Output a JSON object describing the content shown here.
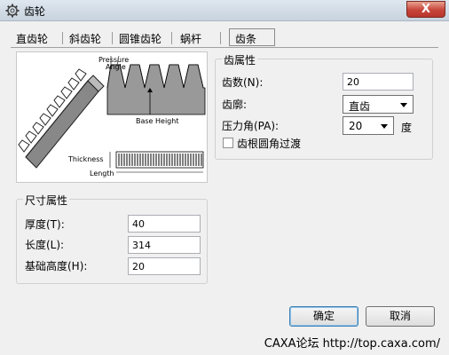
{
  "window": {
    "title": "齿轮",
    "close_label": "X"
  },
  "tabs": [
    {
      "label": "直齿轮"
    },
    {
      "label": "斜齿轮"
    },
    {
      "label": "圆锥齿轮"
    },
    {
      "label": "蜗杆"
    },
    {
      "label": "齿条",
      "active": true
    }
  ],
  "diagram": {
    "pressure_angle": "Pressure Angle",
    "pressure_line1": "Pressure",
    "pressure_line2": "Angle",
    "base_height": "Base Height",
    "thickness": "Thickness",
    "length": "Length"
  },
  "tooth_group": {
    "title": "齿属性",
    "count_label": "齿数(N):",
    "count_value": "20",
    "profile_label": "齿廓:",
    "profile_value": "直齿",
    "pressure_label": "压力角(PA):",
    "pressure_value": "20",
    "pressure_unit": "度",
    "fillet_label": "齿根圆角过渡",
    "fillet_checked": false
  },
  "size_group": {
    "title": "尺寸属性",
    "thickness_label": "厚度(T):",
    "thickness_value": "40",
    "length_label": "长度(L):",
    "length_value": "314",
    "base_label": "基础高度(H):",
    "base_value": "20"
  },
  "buttons": {
    "ok": "确定",
    "cancel": "取消"
  },
  "footer": {
    "watermark": "CAXA论坛 http://top.caxa.com/"
  }
}
